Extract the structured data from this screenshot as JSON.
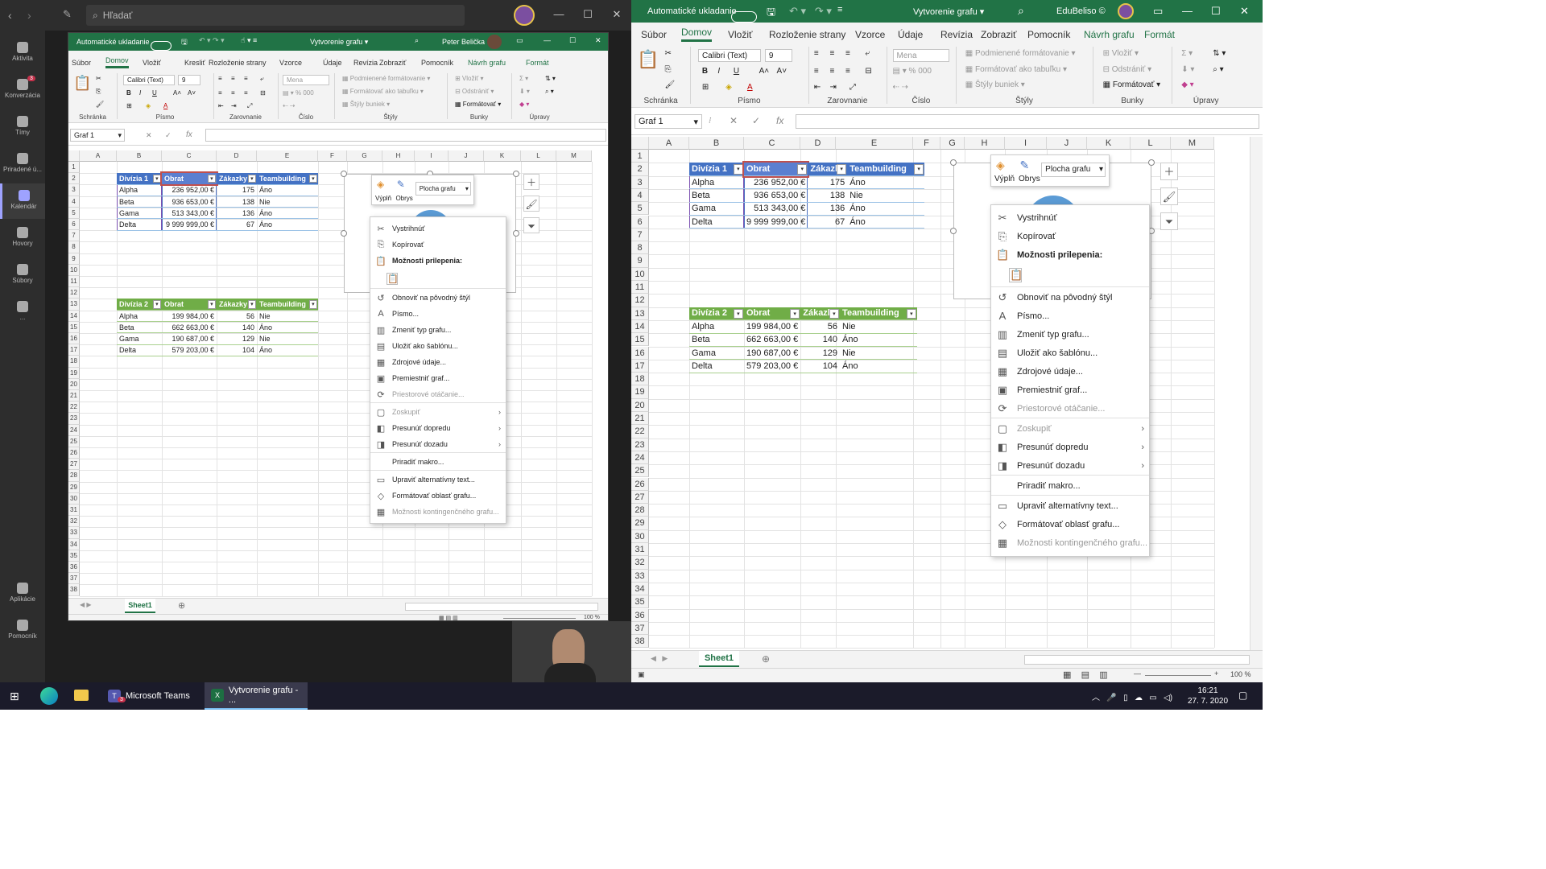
{
  "teams": {
    "search_placeholder": "Hľadať",
    "rail": [
      {
        "label": "Aktivita",
        "icon": "bell-icon"
      },
      {
        "label": "Konverzácia",
        "icon": "chat-icon",
        "badge": "3"
      },
      {
        "label": "Tímy",
        "icon": "teams-icon"
      },
      {
        "label": "Priradené ú...",
        "icon": "assignments-icon"
      },
      {
        "label": "Kalendár",
        "icon": "calendar-icon",
        "active": true
      },
      {
        "label": "Hovory",
        "icon": "phone-icon"
      },
      {
        "label": "Súbory",
        "icon": "files-icon"
      },
      {
        "label": "...",
        "icon": "more-icon"
      },
      {
        "label": "Aplikácie",
        "icon": "apps-icon"
      },
      {
        "label": "Pomocník",
        "icon": "help-icon"
      }
    ]
  },
  "excel": {
    "autosave": "Automatické ukladanie",
    "title": "Vytvorenie grafu ▾",
    "user_left": "Peter Belička",
    "user_right": "EduBeliso ©",
    "tabs": [
      "Súbor",
      "Domov",
      "Vložiť",
      "Kresliť",
      "Rozloženie strany",
      "Vzorce",
      "Údaje",
      "Revízia",
      "Zobraziť",
      "Pomocník",
      "Návrh grafu",
      "Formát"
    ],
    "tabs_right": [
      "Súbor",
      "Domov",
      "Vložiť",
      "Rozloženie strany",
      "Vzorce",
      "Údaje",
      "Revízia",
      "Zobraziť",
      "Pomocník",
      "Návrh grafu",
      "Formát"
    ],
    "ribbon": {
      "paste": "Prilepiť",
      "font_name": "Calibri (Text)",
      "font_size": "9",
      "number_format": "Mena",
      "cond_format": "Podmienené formátovanie",
      "format_table": "Formátovať ako tabuľku",
      "cell_styles": "Štýly buniek",
      "insert": "Vložiť",
      "delete": "Odstrániť",
      "format": "Formátovať",
      "groups": [
        "Schránka",
        "Písmo",
        "Zarovnanie",
        "Číslo",
        "Štýly",
        "Bunky",
        "Úpravy"
      ]
    },
    "name_box": "Graf 1",
    "fx": "fx",
    "columns": [
      "A",
      "B",
      "C",
      "D",
      "E",
      "F",
      "G",
      "H",
      "I",
      "J",
      "K",
      "L",
      "M"
    ],
    "rows": [
      "1",
      "2",
      "3",
      "4",
      "5",
      "6",
      "7",
      "8",
      "9",
      "10",
      "11",
      "12",
      "13",
      "14",
      "15",
      "16",
      "17",
      "18",
      "19",
      "20",
      "21",
      "22",
      "23",
      "24",
      "25",
      "26",
      "27",
      "28",
      "29",
      "30",
      "31",
      "32",
      "33",
      "34",
      "35",
      "36",
      "37",
      "38"
    ],
    "table1": {
      "headers": [
        "Divízia 1",
        "Obrat",
        "Zákazky",
        "Teambuilding"
      ],
      "rows": [
        [
          "Alpha",
          "236 952,00 €",
          "175",
          "Áno"
        ],
        [
          "Beta",
          "936 653,00 €",
          "138",
          "Nie"
        ],
        [
          "Gama",
          "513 343,00 €",
          "136",
          "Áno"
        ],
        [
          "Delta",
          "9 999 999,00 €",
          "67",
          "Áno"
        ]
      ]
    },
    "table2": {
      "headers": [
        "Divízia 2",
        "Obrat",
        "Zákazky",
        "Teambuilding"
      ],
      "rows": [
        [
          "Alpha",
          "199 984,00 €",
          "56",
          "Nie"
        ],
        [
          "Beta",
          "662 663,00 €",
          "140",
          "Áno"
        ],
        [
          "Gama",
          "190 687,00 €",
          "129",
          "Nie"
        ],
        [
          "Delta",
          "579 203,00 €",
          "104",
          "Áno"
        ]
      ]
    },
    "mini_toolbar": {
      "fill": "Výplň",
      "outline": "Obrys",
      "element": "Plocha grafu"
    },
    "context_menu": [
      {
        "label": "Vystrihnúť",
        "icon": "cut-icon"
      },
      {
        "label": "Kopírovať",
        "icon": "copy-icon"
      },
      {
        "label": "Možnosti prilepenia:",
        "icon": "paste-icon",
        "bold": true
      },
      {
        "label": "",
        "icon": "paste-option-icon",
        "paste_opt": true
      },
      {
        "label": "Obnoviť na pôvodný štýl",
        "icon": "reset-icon",
        "sep_before": true
      },
      {
        "label": "Písmo...",
        "icon": "font-icon"
      },
      {
        "label": "Zmeniť typ grafu...",
        "icon": "chart-type-icon"
      },
      {
        "label": "Uložiť ako šablónu...",
        "icon": "template-icon"
      },
      {
        "label": "Zdrojové údaje...",
        "icon": "data-source-icon"
      },
      {
        "label": "Premiestniť graf...",
        "icon": "move-chart-icon"
      },
      {
        "label": "Priestorové otáčanie...",
        "icon": "rotate-3d-icon",
        "disabled": true
      },
      {
        "label": "Zoskupiť",
        "icon": "group-icon",
        "disabled": true,
        "sub": true,
        "sep_before": true
      },
      {
        "label": "Presunúť dopredu",
        "icon": "bring-forward-icon",
        "sub": true
      },
      {
        "label": "Presunúť dozadu",
        "icon": "send-backward-icon",
        "sub": true
      },
      {
        "label": "Priradiť makro...",
        "icon": "",
        "sep_before": true
      },
      {
        "label": "Upraviť alternatívny text...",
        "icon": "alt-text-icon",
        "sep_before": true
      },
      {
        "label": "Formátovať oblasť grafu...",
        "icon": "format-area-icon"
      },
      {
        "label": "Možnosti kontingenčného grafu...",
        "icon": "pivot-chart-icon",
        "disabled": true
      }
    ],
    "sheet_tab": "Sheet1",
    "zoom": "100 %"
  },
  "taskbar": {
    "items": [
      {
        "label": "Microsoft Teams",
        "icon": "teams-app-icon",
        "badge": "3"
      },
      {
        "label": "Vytvorenie grafu - ...",
        "icon": "excel-app-icon",
        "active": true
      }
    ],
    "time": "16:21",
    "date": "27. 7. 2020"
  },
  "colors": {
    "excel_green": "#217346",
    "table_blue": "#4472c4",
    "table_green": "#70ad47",
    "teams_dark": "#1f1f1f"
  }
}
